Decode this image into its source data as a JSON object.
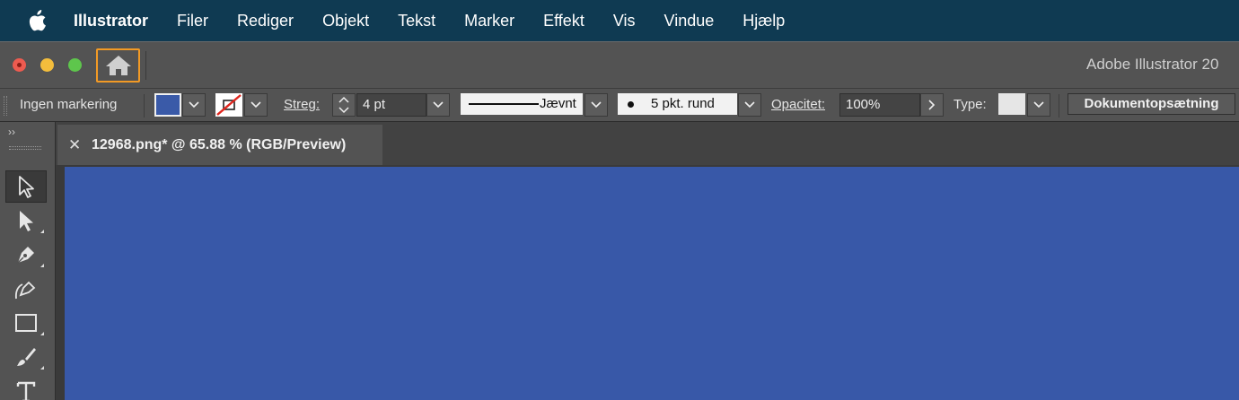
{
  "menubar": {
    "app": "Illustrator",
    "items": [
      "Filer",
      "Rediger",
      "Objekt",
      "Tekst",
      "Marker",
      "Effekt",
      "Vis",
      "Vindue",
      "Hjælp"
    ]
  },
  "window": {
    "title": "Adobe Illustrator 20"
  },
  "controlbar": {
    "selection_label": "Ingen markering",
    "stroke_label": "Streg:",
    "stroke_weight": "4 pt",
    "stroke_profile": "Jævnt",
    "brush": "5 pkt. rund",
    "opacity_label": "Opacitet:",
    "opacity_value": "100%",
    "type_label": "Type:",
    "document_setup": "Dokumentopsætning"
  },
  "document_tab": {
    "title": "12968.png* @ 65.88 % (RGB/Preview)",
    "close": "✕"
  },
  "tools_panel": {
    "collapse": "››"
  },
  "colors": {
    "menubar": "#0f3a52",
    "fill": "#3a5aa8",
    "artboard": "#3858a8",
    "highlight": "#f29a25"
  }
}
